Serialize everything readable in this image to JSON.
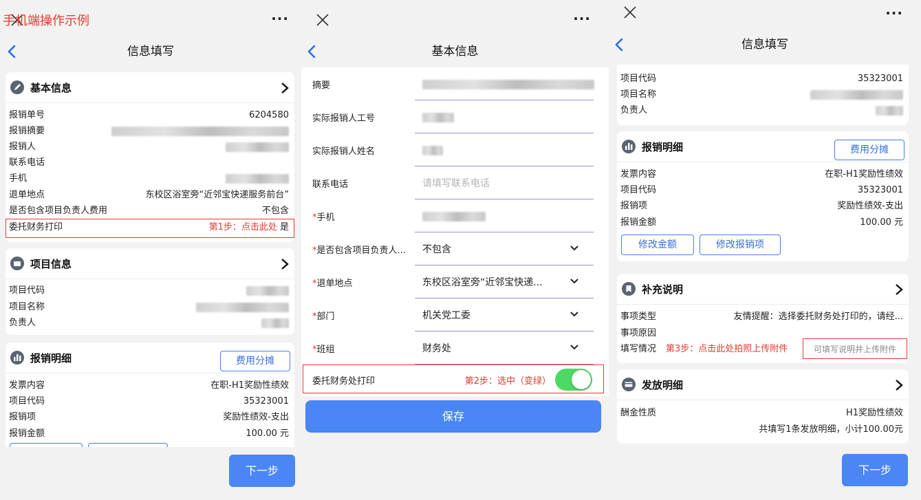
{
  "s1": {
    "watermark": "手机端操作示例",
    "more": "···",
    "title": "信息填写",
    "basic": {
      "title": "基本信息",
      "rows": [
        {
          "label": "报销单号",
          "value": "6204580"
        },
        {
          "label": "报销摘要",
          "value": ""
        },
        {
          "label": "报销人",
          "value": ""
        },
        {
          "label": "联系电话",
          "value": ""
        },
        {
          "label": "手机",
          "value": ""
        },
        {
          "label": "退单地点",
          "value": "东校区浴室旁“近邻宝快递服务前台”"
        },
        {
          "label": "是否包含项目负责人费用",
          "value": "不包含"
        }
      ],
      "entrust_label": "委托财务打印",
      "step_hint": "第1步：点击此处",
      "entrust_value": "是"
    },
    "project": {
      "title": "项目信息",
      "rows": [
        {
          "label": "项目代码",
          "value": ""
        },
        {
          "label": "项目名称",
          "value": ""
        },
        {
          "label": "负责人",
          "value": ""
        }
      ]
    },
    "detail": {
      "title": "报销明细",
      "split_button": "费用分摊",
      "rows": [
        {
          "label": "发票内容",
          "value": "在职-H1奖励性绩效"
        },
        {
          "label": "项目代码",
          "value": "35323001"
        },
        {
          "label": "报销项",
          "value": "奖励性绩效-支出"
        },
        {
          "label": "报销金额",
          "value": "100.00 元"
        }
      ]
    },
    "next_button": "下一步"
  },
  "s2": {
    "more": "···",
    "title": "基本信息",
    "fields": [
      {
        "label": "摘要",
        "required": false,
        "value": "",
        "placeholder": ""
      },
      {
        "label": "实际报销人工号",
        "required": false,
        "value": "",
        "placeholder": ""
      },
      {
        "label": "实际报销人姓名",
        "required": false,
        "value": "",
        "placeholder": ""
      },
      {
        "label": "联系电话",
        "required": false,
        "value": "",
        "placeholder": "请填写联系电话"
      },
      {
        "label": "手机",
        "required": true,
        "value": "",
        "placeholder": ""
      },
      {
        "label": "是否包含项目负责人...",
        "required": true,
        "value": "不包含",
        "placeholder": ""
      },
      {
        "label": "退单地点",
        "required": true,
        "value": "东校区浴室旁“近邻宝快递...",
        "placeholder": ""
      },
      {
        "label": "部门",
        "required": true,
        "value": "机关党工委",
        "placeholder": ""
      },
      {
        "label": "班组",
        "required": true,
        "value": "财务处",
        "placeholder": ""
      }
    ],
    "star": "*",
    "toggle_label": "委托财务处打印",
    "step_hint": "第2步：选中（变绿）",
    "toggle_on": true,
    "save_button": "保存",
    "colors": {
      "primary": "#4a86f5",
      "toggle_on": "#4cd964",
      "hint": "#e23b2e"
    }
  },
  "s3": {
    "more": "···",
    "title": "信息填写",
    "project_rows": [
      {
        "label": "项目代码",
        "value": "35323001"
      },
      {
        "label": "项目名称",
        "value": ""
      },
      {
        "label": "负责人",
        "value": ""
      }
    ],
    "detail": {
      "title": "报销明细",
      "split_button": "费用分摊",
      "rows": [
        {
          "label": "发票内容",
          "value": "在职-H1奖励性绩效"
        },
        {
          "label": "项目代码",
          "value": "35323001"
        },
        {
          "label": "报销项",
          "value": "奖励性绩效-支出"
        },
        {
          "label": "报销金额",
          "value": "100.00 元"
        }
      ],
      "edit_amount_button": "修改金额",
      "edit_item_button": "修改报销项"
    },
    "supplement": {
      "title": "补充说明",
      "type_label": "事项类型",
      "type_value": "友情提醒：选择委托财务处打印的，请经...",
      "reason_label": "事项原因",
      "fill_label": "填写情况",
      "step_hint": "第3步：点击此处拍照上传附件",
      "fill_placeholder": "可填写说明并上传附件"
    },
    "payout": {
      "title": "发放明细",
      "nature_label": "酬金性质",
      "nature_value": "H1奖励性绩效",
      "summary": "共填写1条发放明细，小计100.00元"
    },
    "next_button": "下一步"
  }
}
